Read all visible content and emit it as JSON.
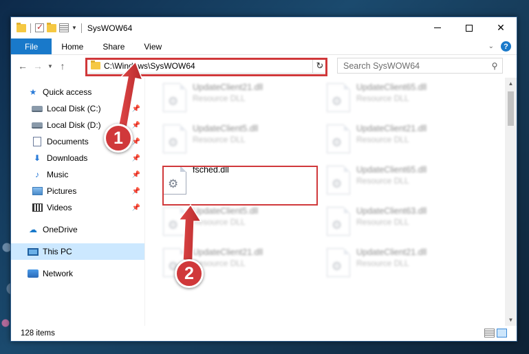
{
  "window": {
    "title": "SysWOW64",
    "controls": {
      "minimize": "–",
      "maximize": "☐",
      "close": "✕"
    }
  },
  "ribbon": {
    "tabs": [
      {
        "label": "File"
      },
      {
        "label": "Home"
      },
      {
        "label": "Share"
      },
      {
        "label": "View"
      }
    ]
  },
  "address": {
    "path": "C:\\Windows\\SysWOW64"
  },
  "search": {
    "placeholder": "Search SysWOW64"
  },
  "sidebar": {
    "items": [
      {
        "label": "Quick access",
        "icon": "star-icon"
      },
      {
        "label": "Local Disk (C:)",
        "icon": "disk-icon",
        "pinned": true
      },
      {
        "label": "Local Disk (D:)",
        "icon": "disk-icon",
        "pinned": true
      },
      {
        "label": "Documents",
        "icon": "document-icon",
        "pinned": true
      },
      {
        "label": "Downloads",
        "icon": "download-icon",
        "pinned": true
      },
      {
        "label": "Music",
        "icon": "music-icon",
        "pinned": true
      },
      {
        "label": "Pictures",
        "icon": "pictures-icon",
        "pinned": true
      },
      {
        "label": "Videos",
        "icon": "videos-icon",
        "pinned": true
      },
      {
        "label": "OneDrive",
        "icon": "cloud-icon"
      },
      {
        "label": "This PC",
        "icon": "computer-icon",
        "selected": true
      },
      {
        "label": "Network",
        "icon": "network-icon"
      }
    ]
  },
  "files": [
    {
      "name": "UpdateClient21.dll",
      "type": "Resource DLL",
      "blurred": true
    },
    {
      "name": "UpdateClient65.dll",
      "type": "Resource DLL",
      "blurred": true
    },
    {
      "name": "UpdateClient5.dll",
      "type": "Resource DLL",
      "blurred": true
    },
    {
      "name": "UpdateClient21.dll",
      "type": "Resource DLL",
      "blurred": true
    },
    {
      "name": "fsched.dll",
      "type": "",
      "blurred": false,
      "highlighted": true
    },
    {
      "name": "UpdateClient65.dll",
      "type": "Resource DLL",
      "blurred": true
    },
    {
      "name": "UpdateClient5.dll",
      "type": "Resource DLL",
      "blurred": true
    },
    {
      "name": "UpdateClient63.dll",
      "type": "Resource DLL",
      "blurred": true
    },
    {
      "name": "UpdateClient21.dll",
      "type": "Resource DLL",
      "blurred": true
    },
    {
      "name": "UpdateClient21.dll",
      "type": "Resource DLL",
      "blurred": true
    }
  ],
  "status": {
    "item_count": "128 items"
  },
  "callouts": {
    "one": "1",
    "two": "2"
  },
  "colors": {
    "accent": "#1979ca",
    "highlight": "#d0383a",
    "selected": "#cce8ff"
  }
}
